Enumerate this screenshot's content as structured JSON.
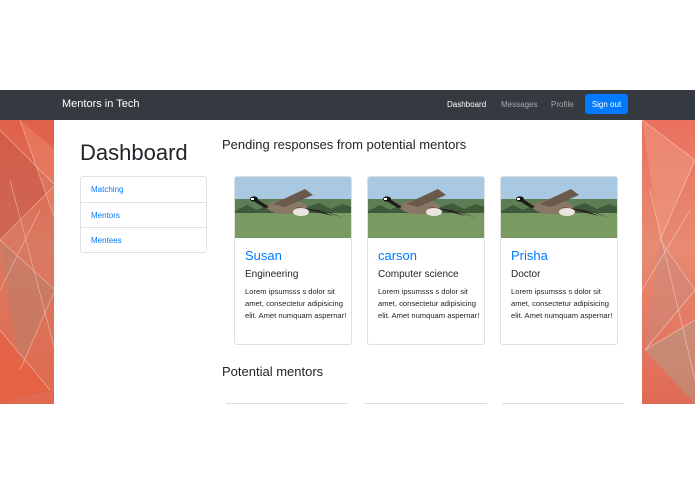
{
  "navbar": {
    "brand": "Mentors in Tech",
    "links": [
      {
        "label": "Dashboard",
        "active": true
      },
      {
        "label": "Messages",
        "active": false
      },
      {
        "label": "Profile",
        "active": false
      }
    ],
    "signout_label": "Sign out"
  },
  "sidebar": {
    "title": "Dashboard",
    "items": [
      {
        "label": "Matching"
      },
      {
        "label": "Mentors"
      },
      {
        "label": "Mentees"
      }
    ]
  },
  "pending": {
    "title": "Pending responses from potential mentors",
    "cards": [
      {
        "name": "Susan",
        "occupation": "Engineering",
        "text": "Lorem ipsumsss s dolor sit amet, consectetur adipisicing elit. Amet numquam aspernar!"
      },
      {
        "name": "carson",
        "occupation": "Computer science",
        "text": "Lorem ipsumsss s dolor sit amet, consectetur adipisicing elit. Amet numquam aspernar!"
      },
      {
        "name": "Prisha",
        "occupation": "Doctor",
        "text": "Lorem ipsumsss s dolor sit amet, consectetur adipisicing elit. Amet numquam aspernar!"
      }
    ]
  },
  "potential": {
    "title": "Potential mentors"
  },
  "colors": {
    "navbar": "#343a40",
    "accent": "#007bff",
    "background_warm": "#e2775f"
  }
}
